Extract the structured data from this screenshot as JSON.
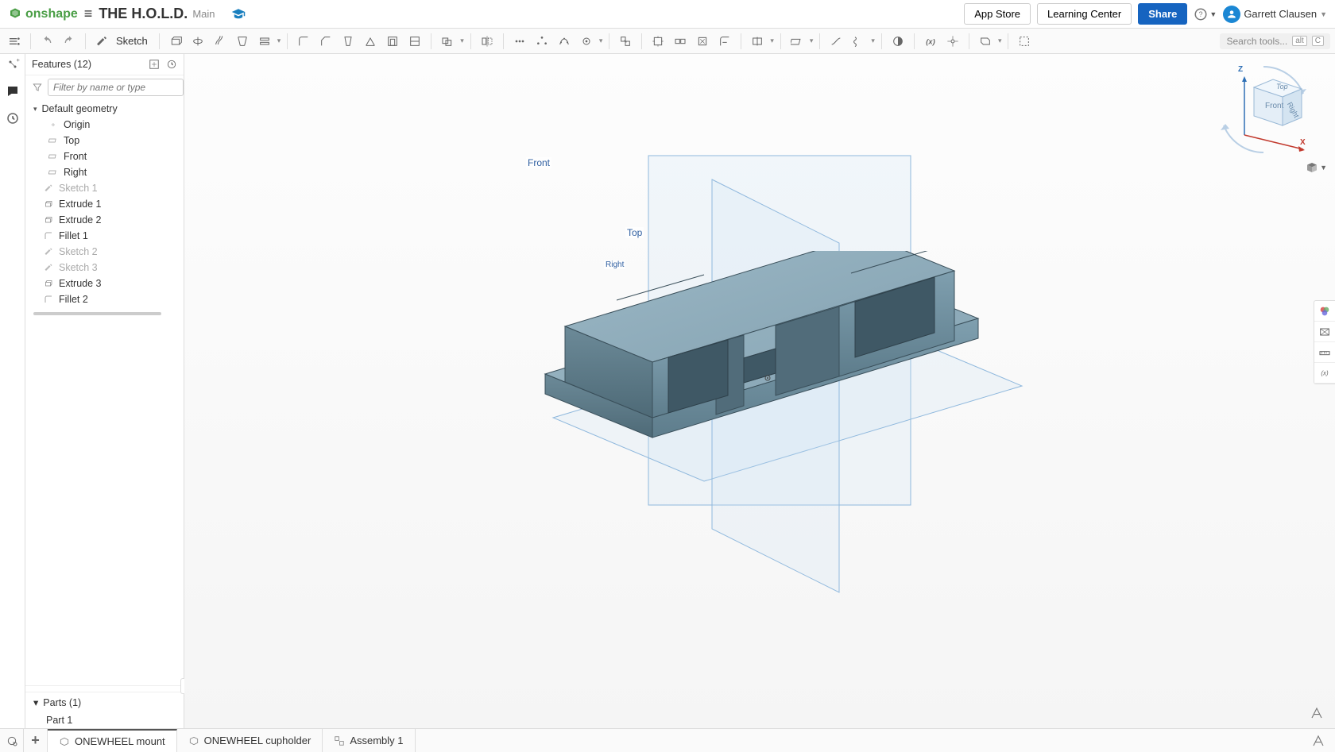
{
  "header": {
    "logo": "onshape",
    "doc_title": "THE H.O.L.D.",
    "doc_branch": "Main",
    "app_store": "App Store",
    "learning_center": "Learning Center",
    "share": "Share",
    "user_name": "Garrett Clausen"
  },
  "toolbar": {
    "sketch_label": "Sketch",
    "search_placeholder": "Search tools...",
    "kbd1": "alt",
    "kbd2": "C"
  },
  "sidebar": {
    "features_label": "Features (12)",
    "filter_placeholder": "Filter by name or type",
    "default_geometry": "Default geometry",
    "origin": "Origin",
    "top": "Top",
    "front": "Front",
    "right": "Right",
    "items": [
      {
        "label": "Sketch 1",
        "dim": true,
        "icon": "pencil"
      },
      {
        "label": "Extrude 1",
        "dim": false,
        "icon": "extrude"
      },
      {
        "label": "Extrude 2",
        "dim": false,
        "icon": "extrude"
      },
      {
        "label": "Fillet 1",
        "dim": false,
        "icon": "fillet"
      },
      {
        "label": "Sketch 2",
        "dim": true,
        "icon": "pencil"
      },
      {
        "label": "Sketch 3",
        "dim": true,
        "icon": "pencil"
      },
      {
        "label": "Extrude 3",
        "dim": false,
        "icon": "extrude"
      },
      {
        "label": "Fillet 2",
        "dim": false,
        "icon": "fillet"
      }
    ],
    "parts_label": "Parts (1)",
    "part1": "Part 1"
  },
  "viewport": {
    "plane_front": "Front",
    "plane_top": "Top",
    "plane_right": "Right",
    "axis_z": "Z",
    "axis_x": "X",
    "cube_front": "Front",
    "cube_top": "Top",
    "cube_right": "Right"
  },
  "tabs": {
    "t1": "ONEWHEEL mount",
    "t2": "ONEWHEEL cupholder",
    "t3": "Assembly 1"
  }
}
